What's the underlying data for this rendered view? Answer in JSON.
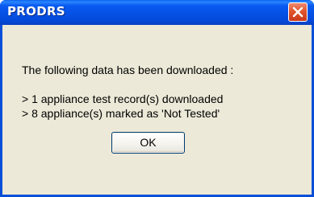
{
  "window": {
    "title": "PRODRS",
    "close_icon": "close-icon"
  },
  "message": {
    "heading": "The following data has been downloaded :",
    "lines": [
      "> 1 appliance test record(s) downloaded",
      "> 8 appliance(s) marked as 'Not Tested'"
    ]
  },
  "buttons": {
    "ok_label": "OK"
  },
  "colors": {
    "titlebar": "#0551e6",
    "close_button": "#e2552c",
    "dialog_background": "#ece9d8"
  }
}
